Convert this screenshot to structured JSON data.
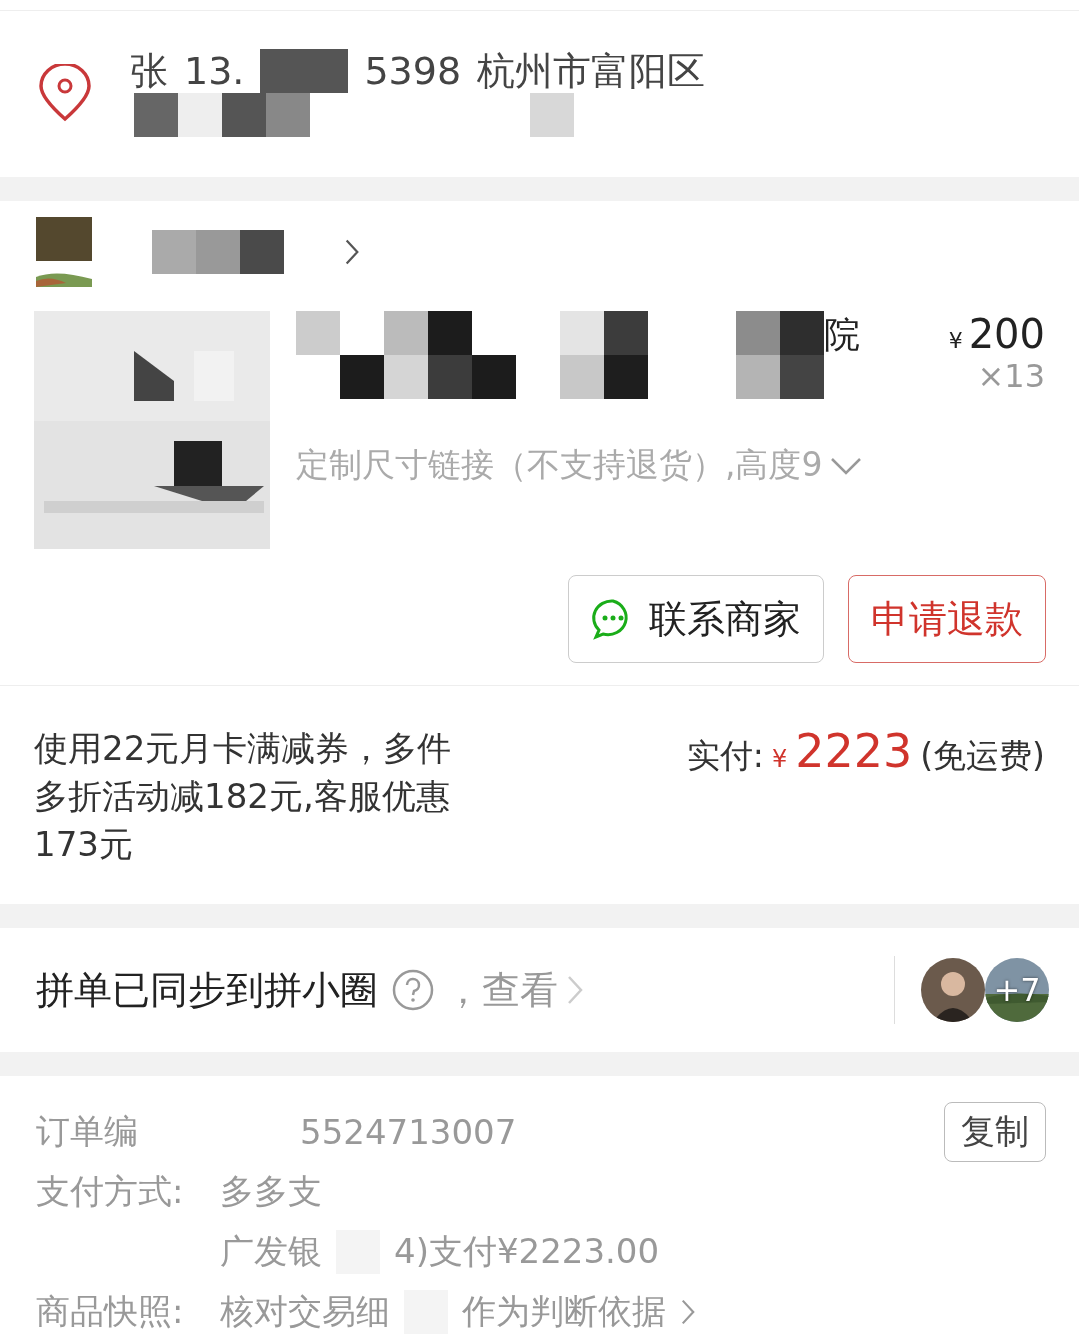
{
  "address": {
    "name": "张",
    "phone_start": "13.",
    "phone_end": "5398",
    "region": "杭州市富阳区"
  },
  "product": {
    "title_fragment": "院",
    "price_symbol": "¥",
    "price": "200",
    "quantity": "×13",
    "spec": "定制尺寸链接（不支持退货）,高度9"
  },
  "actions": [
    {
      "label": "联系商家",
      "kind": "contact"
    },
    {
      "label": "申请退款",
      "kind": "refund"
    }
  ],
  "summary": {
    "discount_note": "使用22元月卡满减券，多件多折活动减182元,客服优惠173元",
    "paid_label": "实付:",
    "currency": "¥",
    "paid_amount": "2223",
    "shipping_note": "(免运费)"
  },
  "group": {
    "text": "拼单已同步到拼小圈",
    "link": "，查看",
    "more_count": "+7"
  },
  "order_info": [
    {
      "label": "订单编",
      "parts": [
        "5524713007"
      ],
      "kind": "copy",
      "button": "复制",
      "link": false
    },
    {
      "label": "支付方式:",
      "parts": [
        "多多支"
      ],
      "kind": "plain",
      "link": false
    },
    {
      "parts": [
        "广发银",
        "4)支付¥2223.00"
      ],
      "kind": "plain",
      "link": false
    },
    {
      "label": "商品快照:",
      "parts": [
        "核对交易细",
        "作为判断依据"
      ],
      "kind": "plain",
      "link": true
    }
  ]
}
